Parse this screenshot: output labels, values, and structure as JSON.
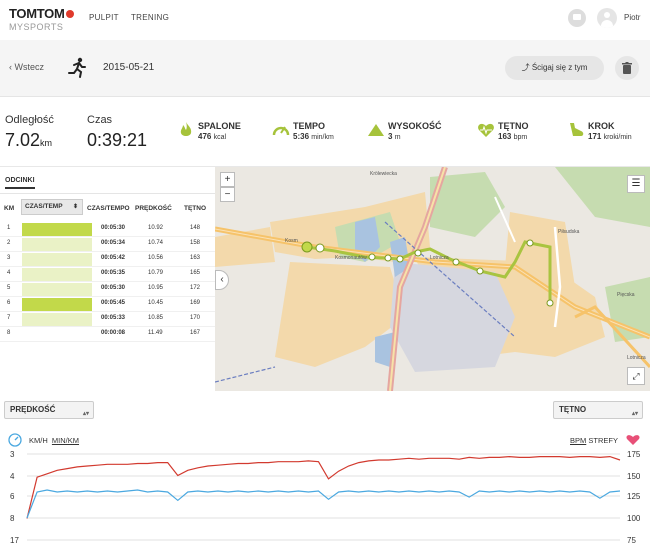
{
  "nav": {
    "brand_top": "TOMTOM",
    "brand_bottom": "MYSPORTS",
    "links": [
      "PULPIT",
      "TRENING"
    ],
    "user": "Piotr"
  },
  "activity": {
    "back_label": "Wstecz",
    "date": "2015-05-21",
    "race_label": "Ścigaj się z tym"
  },
  "stats": {
    "distance_label": "Odległość",
    "distance_value": "7.02",
    "distance_unit": "km",
    "time_label": "Czas",
    "time_value": "0:39:21",
    "metrics": [
      {
        "title": "SPALONE",
        "value": "476",
        "unit": "kcal",
        "icon": "flame-icon"
      },
      {
        "title": "TEMPO",
        "value": "5:36",
        "unit": "min/km",
        "icon": "speedometer-icon"
      },
      {
        "title": "WYSOKOŚĆ",
        "value": "3",
        "unit": "m",
        "icon": "mountain-icon"
      },
      {
        "title": "TĘTNO",
        "value": "163",
        "unit": "bpm",
        "icon": "heart-icon"
      },
      {
        "title": "KROK",
        "value": "171",
        "unit": "kroki/min",
        "icon": "shoe-icon"
      }
    ]
  },
  "splits": {
    "tab": "ODCINKI",
    "headers": {
      "km": "KM",
      "selector": "CZAS/TEMP",
      "pace": "CZAS/TEMPO",
      "speed": "PRĘDKOŚĆ",
      "hr": "TĘTNO"
    },
    "rows": [
      {
        "km": "1",
        "pace": "00:05:30",
        "speed": "10.92",
        "hr": "148",
        "fill": 1.0
      },
      {
        "km": "2",
        "pace": "00:05:34",
        "speed": "10.74",
        "hr": "158",
        "fill": 0.3
      },
      {
        "km": "3",
        "pace": "00:05:42",
        "speed": "10.56",
        "hr": "163",
        "fill": 0.3
      },
      {
        "km": "4",
        "pace": "00:05:35",
        "speed": "10.79",
        "hr": "165",
        "fill": 0.3
      },
      {
        "km": "5",
        "pace": "00:05:30",
        "speed": "10.95",
        "hr": "172",
        "fill": 0.3
      },
      {
        "km": "6",
        "pace": "00:05:45",
        "speed": "10.45",
        "hr": "169",
        "fill": 1.0
      },
      {
        "km": "7",
        "pace": "00:05:33",
        "speed": "10.85",
        "hr": "170",
        "fill": 0.3
      },
      {
        "km": "8",
        "pace": "00:00:08",
        "speed": "11.49",
        "hr": "167",
        "fill": 0.0
      }
    ]
  },
  "map": {
    "labels": [
      "Krölewiecka",
      "Kosm",
      "Kosmonautów",
      "Lotnicza",
      "Lotnicza",
      "Piłsudska",
      "Pięcska"
    ],
    "road_badges": [
      "94",
      "A8",
      "336",
      "167",
      "A8",
      "94",
      "94"
    ]
  },
  "chart": {
    "left_select": "PRĘDKOŚĆ",
    "right_select": "TĘTNO",
    "left_units": [
      "KM/H",
      "MIN/KM"
    ],
    "right_units": [
      "BPM",
      "STREFY"
    ],
    "colors": {
      "hr": "#d23a2f",
      "speed": "#4aa8e0",
      "split_full": "#c2d94a",
      "split_light": "#eaf2c6",
      "route": "#a9c440"
    }
  },
  "chart_data": {
    "type": "line",
    "left_axis": {
      "ticks": [
        3,
        4,
        6,
        8,
        17
      ],
      "inverted": true
    },
    "right_axis": {
      "ticks": [
        175,
        150,
        125,
        100,
        75
      ]
    },
    "series": [
      {
        "name": "TĘTNO",
        "axis": "right",
        "values": [
          100,
          148,
          152,
          156,
          158,
          160,
          161,
          162,
          163,
          163,
          163,
          164,
          164,
          165,
          165,
          150,
          156,
          159,
          161,
          162,
          163,
          164,
          164,
          165,
          165,
          166,
          166,
          166,
          167,
          166,
          146,
          155,
          161,
          165,
          167,
          168,
          168,
          169,
          170,
          169,
          170,
          170,
          170,
          169,
          171,
          170,
          171,
          171,
          172,
          171,
          171,
          172,
          172,
          172,
          171,
          172,
          172,
          171,
          172,
          168
        ]
      },
      {
        "name": "PRĘDKOŚĆ",
        "axis": "left",
        "values": [
          8,
          5.6,
          5.4,
          5.6,
          5.5,
          5.6,
          5.5,
          5.6,
          5.5,
          5.6,
          5.5,
          5.4,
          5.6,
          5.5,
          5.6,
          6.4,
          5.6,
          5.5,
          5.6,
          5.5,
          5.6,
          5.5,
          5.6,
          5.5,
          5.6,
          5.5,
          5.6,
          5.5,
          5.6,
          5.5,
          6.3,
          5.6,
          5.5,
          5.6,
          5.5,
          5.6,
          5.5,
          5.6,
          5.5,
          5.6,
          5.5,
          5.6,
          5.5,
          5.6,
          6.1,
          5.5,
          5.6,
          5.5,
          5.6,
          5.5,
          5.6,
          5.5,
          5.6,
          5.5,
          5.6,
          5.5,
          5.6,
          6.2,
          5.6,
          5.5
        ]
      }
    ]
  }
}
